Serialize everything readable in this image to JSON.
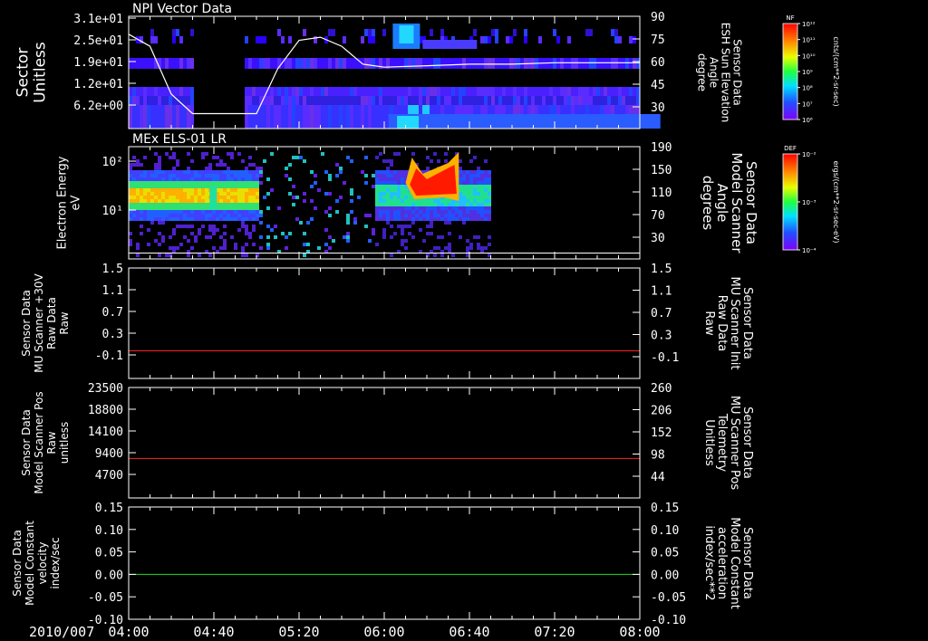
{
  "date_label": "2010/007",
  "time_ticks": [
    "04:00",
    "04:40",
    "05:20",
    "06:00",
    "06:40",
    "07:20",
    "08:00"
  ],
  "chart_data": [
    {
      "type": "heatmap",
      "title": "NPI Vector Data",
      "ylabel": [
        "Sector",
        "Unitless"
      ],
      "y_ticks": [
        "3.1e+01",
        "2.5e+01",
        "1.9e+01",
        "1.2e+01",
        "6.2e+00"
      ],
      "y2label": [
        "Sensor Data",
        "ESH Sun Elevation",
        "Angle",
        "degree"
      ],
      "y2_ticks": [
        "90",
        "75",
        "60",
        "45",
        "30"
      ],
      "colorbar": {
        "label": "NF",
        "unit": "cnts/(cm**2-sr-sec)",
        "ticks": [
          "10¹²",
          "10¹¹",
          "10¹⁰",
          "10⁹",
          "10⁸",
          "10⁷",
          "10⁶"
        ]
      },
      "overlay_line": {
        "name": "Sun Elevation",
        "x": [
          "04:00",
          "04:10",
          "04:20",
          "04:30",
          "04:40",
          "04:50",
          "05:00",
          "05:10",
          "05:20",
          "05:30",
          "05:40",
          "05:50",
          "06:00",
          "06:20",
          "06:40",
          "07:00",
          "07:20",
          "08:00"
        ],
        "y": [
          78,
          70,
          38,
          25,
          25,
          25,
          25,
          55,
          74,
          76,
          70,
          58,
          56,
          57,
          58,
          58,
          59,
          59
        ]
      }
    },
    {
      "type": "heatmap",
      "title": "MEx ELS-01 LR",
      "ylabel": [
        "Electron Energy",
        "eV"
      ],
      "y_ticks": [
        "10²",
        "10¹"
      ],
      "y2label": [
        "Sensor Data",
        "Model Scanner",
        "Angle",
        "degrees"
      ],
      "y2_ticks": [
        "190",
        "150",
        "110",
        "70",
        "30"
      ],
      "colorbar": {
        "label": "DEF",
        "unit": "ergs/(cm**2-sr-sec-eV)",
        "ticks": [
          "10⁻²",
          "10⁻³",
          "10⁻⁴"
        ]
      },
      "overlay_line": {
        "name": "Scanner Angle",
        "x": [
          "04:00",
          "08:00"
        ],
        "y": [
          10,
          10
        ]
      }
    },
    {
      "type": "line",
      "ylabel": [
        "Sensor Data",
        "MU Scanner +30V",
        "Raw Data",
        "Raw"
      ],
      "y_ticks": [
        "1.5",
        "1.1",
        "0.7",
        "0.3",
        "-0.1"
      ],
      "ylim": [
        -0.5,
        1.5
      ],
      "y2label": [
        "Sensor Data",
        "MU Scanner Init",
        "Raw Data",
        "Raw"
      ],
      "y2_ticks": [
        "1.5",
        "1.1",
        "0.7",
        "0.3",
        "-0.1"
      ],
      "series": [
        {
          "x": [
            "04:00",
            "08:00"
          ],
          "y": [
            0.0,
            0.0
          ],
          "color": "#ff2020"
        }
      ]
    },
    {
      "type": "line",
      "ylabel": [
        "Sensor Data",
        "Model Scanner Pos",
        "Raw",
        "unitless"
      ],
      "y_ticks": [
        "23500",
        "18800",
        "14100",
        "9400",
        "4700"
      ],
      "ylim": [
        0,
        23500
      ],
      "y2label": [
        "Sensor Data",
        "MU Scanner Pos",
        "Telemetry",
        "Unitless"
      ],
      "y2_ticks": [
        "260",
        "206",
        "152",
        "98",
        "44"
      ],
      "series": [
        {
          "x": [
            "04:00",
            "08:00"
          ],
          "y": [
            8400,
            8400
          ],
          "color": "#ff2020"
        }
      ]
    },
    {
      "type": "line",
      "ylabel": [
        "Sensor Data",
        "Model Constant",
        "velocity",
        "index/sec"
      ],
      "y_ticks": [
        "0.15",
        "0.10",
        "0.05",
        "0.00",
        "-0.05",
        "-0.10"
      ],
      "ylim": [
        -0.1,
        0.15
      ],
      "y2label": [
        "Sensor Data",
        "Model Constant",
        "acceleration",
        "index/sec**2"
      ],
      "y2_ticks": [
        "0.15",
        "0.10",
        "0.05",
        "0.00",
        "-0.05",
        "-0.10"
      ],
      "series": [
        {
          "x": [
            "04:00",
            "08:00"
          ],
          "y": [
            0.0,
            0.0
          ],
          "color": "#20e020"
        }
      ]
    }
  ],
  "colors": {
    "axis": "#ffffff",
    "red_label": "#ff2020",
    "green_label": "#20e020"
  }
}
